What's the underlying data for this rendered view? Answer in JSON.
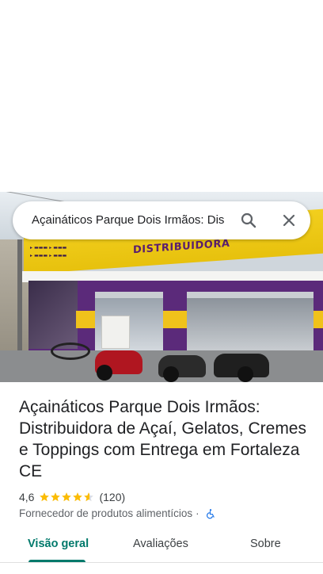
{
  "search": {
    "query": "Açainátic​os Parque Dois Irmãos: Dis"
  },
  "place": {
    "title": "Açainátic​os Parque Dois Irmãos: Distribuidora de Açaí, Gelatos, Cremes e Toppings com Entrega em Fortaleza CE",
    "rating": "4,6",
    "stars": 4.6,
    "review_count": "(120)",
    "category": "Fornecedor de produtos alimentícios",
    "separator": "·"
  },
  "photo": {
    "sign_text": "DISTRIBUIDORA"
  },
  "tabs": [
    {
      "label": "Visão geral",
      "active": true
    },
    {
      "label": "Avaliações",
      "active": false
    },
    {
      "label": "Sobre",
      "active": false
    }
  ],
  "icons": {
    "search": "search-icon",
    "close": "close-icon",
    "star": "star-icon",
    "accessible": "wheelchair-icon"
  },
  "colors": {
    "accent": "#00796b",
    "star": "#fbbc04",
    "accessible": "#1a73e8"
  }
}
